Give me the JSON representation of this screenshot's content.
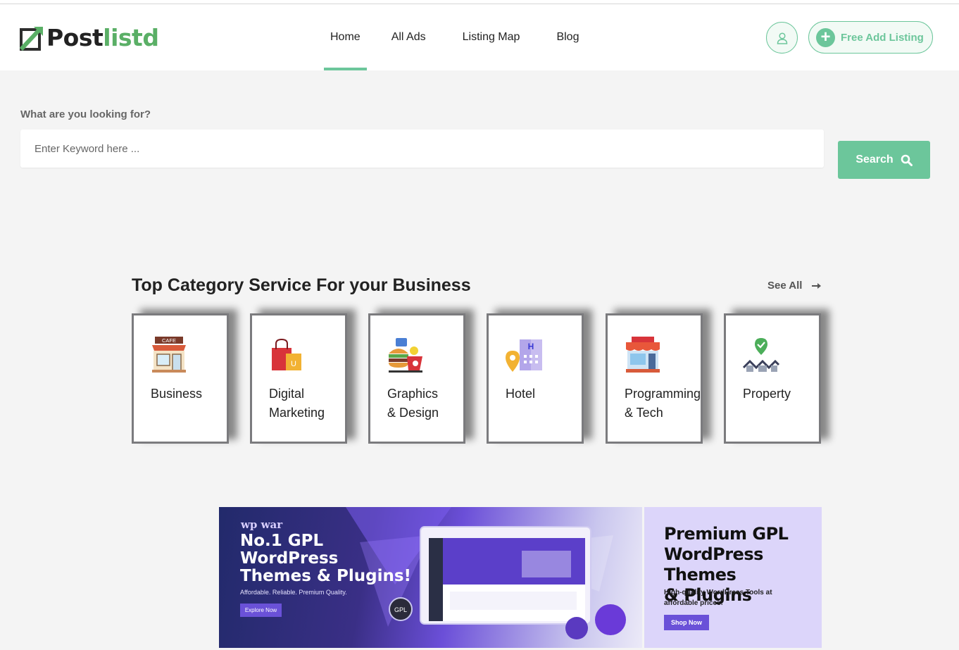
{
  "brand": {
    "name_part1": "Post",
    "name_part2": "listd",
    "accent": "#6cc69b",
    "logo_green": "#5aaf66"
  },
  "nav": {
    "items": [
      {
        "label": "Home",
        "active": true
      },
      {
        "label": "All Ads",
        "active": false
      },
      {
        "label": "Listing Map",
        "active": false
      },
      {
        "label": "Blog",
        "active": false
      }
    ],
    "user_icon": "user-icon",
    "listing_button": "Free Add Listing"
  },
  "search": {
    "label": "What are you looking for?",
    "placeholder": "Enter Keyword here ...",
    "value": "",
    "button": "Search"
  },
  "categories": {
    "title": "Top Category Service For your Business",
    "see_all": "See All",
    "items": [
      {
        "label": "Business",
        "icon": "cafe-icon"
      },
      {
        "label": "Digital\nMarketing",
        "icon": "shopping-bag-icon"
      },
      {
        "label": "Graphics\n& Design",
        "icon": "food-icon"
      },
      {
        "label": "Hotel",
        "icon": "hotel-icon"
      },
      {
        "label": "Programming\n& Tech",
        "icon": "store-icon"
      },
      {
        "label": "Property",
        "icon": "property-icon"
      }
    ]
  },
  "banner": {
    "brand": "wp war",
    "headline": "No.1 GPL\nWordPress\nThemes & Plugins!",
    "tagline": "Affordable. Reliable. Premium Quality.",
    "left_button": "Explore Now",
    "right_title": "Premium GPL\nWordPress Themes\n& Plugins",
    "right_subtitle": "High-quality WordPress Tools at affordable prices!",
    "right_button": "Shop Now"
  }
}
